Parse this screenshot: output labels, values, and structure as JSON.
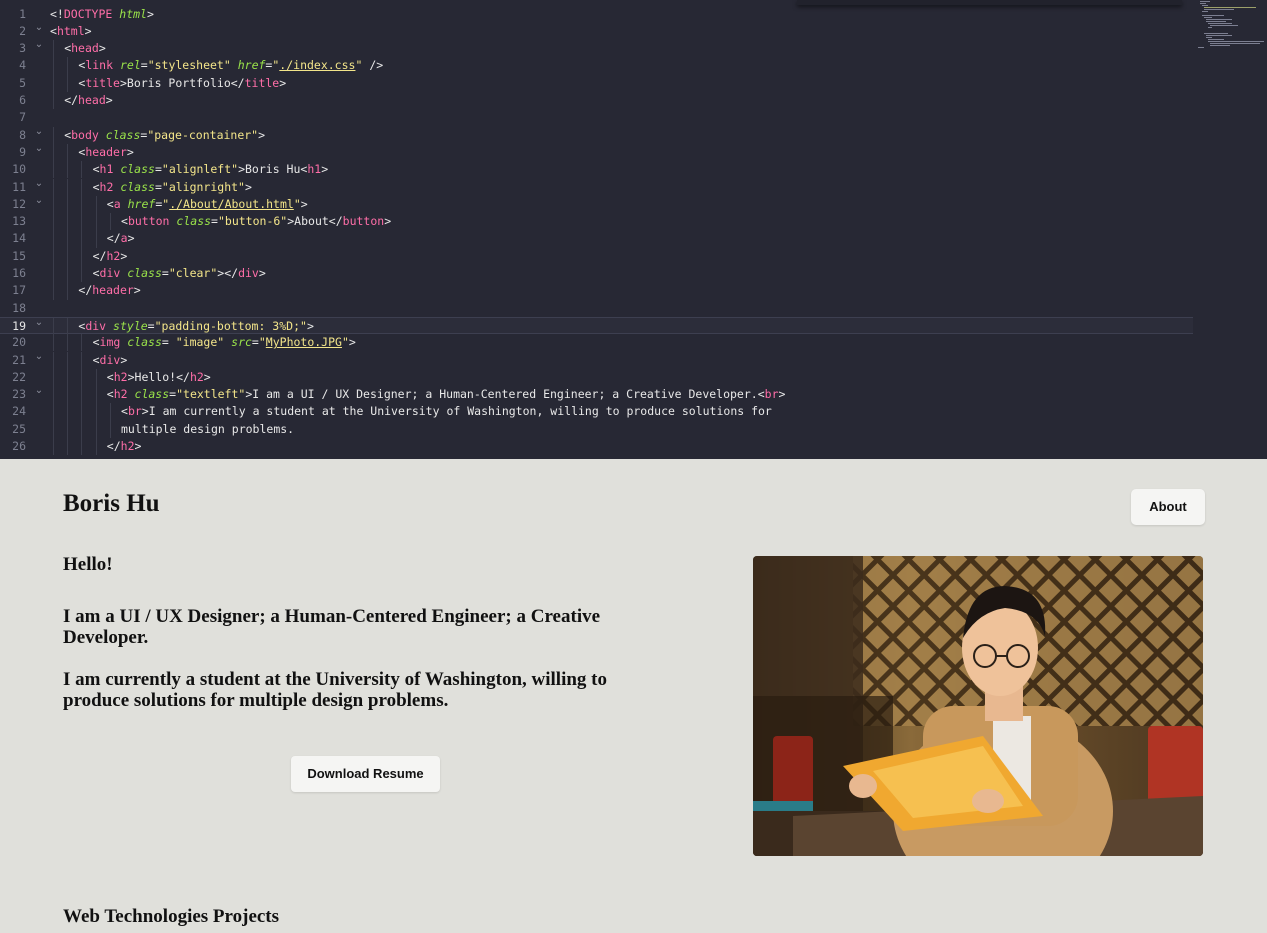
{
  "editor": {
    "lines": [
      {
        "n": "1",
        "fold": "",
        "indent": 0,
        "tokens": [
          [
            "punc",
            "<!"
          ],
          [
            "kw",
            "DOCTYPE"
          ],
          [
            "punc",
            " "
          ],
          [
            "ital",
            "html"
          ],
          [
            "punc",
            ">"
          ]
        ]
      },
      {
        "n": "2",
        "fold": "v",
        "indent": 0,
        "tokens": [
          [
            "punc",
            "<"
          ],
          [
            "tag",
            "html"
          ],
          [
            "punc",
            ">"
          ]
        ]
      },
      {
        "n": "3",
        "fold": "v",
        "indent": 1,
        "tokens": [
          [
            "punc",
            "<"
          ],
          [
            "tag",
            "head"
          ],
          [
            "punc",
            ">"
          ]
        ]
      },
      {
        "n": "4",
        "fold": "",
        "indent": 2,
        "tokens": [
          [
            "punc",
            "<"
          ],
          [
            "tag",
            "link"
          ],
          [
            "punc",
            " "
          ],
          [
            "attr",
            "rel"
          ],
          [
            "punc",
            "="
          ],
          [
            "str",
            "\"stylesheet\""
          ],
          [
            "punc",
            " "
          ],
          [
            "attr",
            "href"
          ],
          [
            "punc",
            "="
          ],
          [
            "str",
            "\""
          ],
          [
            "link",
            "./index.css"
          ],
          [
            "str",
            "\""
          ],
          [
            "punc",
            " />"
          ]
        ]
      },
      {
        "n": "5",
        "fold": "",
        "indent": 2,
        "tokens": [
          [
            "punc",
            "<"
          ],
          [
            "tag",
            "title"
          ],
          [
            "punc",
            ">"
          ],
          [
            "text",
            "Boris Portfolio"
          ],
          [
            "punc",
            "</"
          ],
          [
            "tag",
            "title"
          ],
          [
            "punc",
            ">"
          ]
        ]
      },
      {
        "n": "6",
        "fold": "",
        "indent": 1,
        "tokens": [
          [
            "punc",
            "</"
          ],
          [
            "tag",
            "head"
          ],
          [
            "punc",
            ">"
          ]
        ]
      },
      {
        "n": "7",
        "fold": "",
        "indent": 0,
        "tokens": []
      },
      {
        "n": "8",
        "fold": "v",
        "indent": 1,
        "tokens": [
          [
            "punc",
            "<"
          ],
          [
            "tag",
            "body"
          ],
          [
            "punc",
            " "
          ],
          [
            "attr",
            "class"
          ],
          [
            "punc",
            "="
          ],
          [
            "str",
            "\"page-container\""
          ],
          [
            "punc",
            ">"
          ]
        ]
      },
      {
        "n": "9",
        "fold": "v",
        "indent": 2,
        "tokens": [
          [
            "punc",
            "<"
          ],
          [
            "tag",
            "header"
          ],
          [
            "punc",
            ">"
          ]
        ]
      },
      {
        "n": "10",
        "fold": "",
        "indent": 3,
        "tokens": [
          [
            "punc",
            "<"
          ],
          [
            "tag",
            "h1"
          ],
          [
            "punc",
            " "
          ],
          [
            "attr",
            "class"
          ],
          [
            "punc",
            "="
          ],
          [
            "str",
            "\"alignleft\""
          ],
          [
            "punc",
            ">"
          ],
          [
            "text",
            "Boris Hu"
          ],
          [
            "punc",
            "<"
          ],
          [
            "tag",
            "h1"
          ],
          [
            "punc",
            ">"
          ]
        ]
      },
      {
        "n": "11",
        "fold": "v",
        "indent": 3,
        "tokens": [
          [
            "punc",
            "<"
          ],
          [
            "tag",
            "h2"
          ],
          [
            "punc",
            " "
          ],
          [
            "attr",
            "class"
          ],
          [
            "punc",
            "="
          ],
          [
            "str",
            "\"alignright\""
          ],
          [
            "punc",
            ">"
          ]
        ]
      },
      {
        "n": "12",
        "fold": "v",
        "indent": 4,
        "tokens": [
          [
            "punc",
            "<"
          ],
          [
            "tag",
            "a"
          ],
          [
            "punc",
            " "
          ],
          [
            "attr",
            "href"
          ],
          [
            "punc",
            "="
          ],
          [
            "str",
            "\""
          ],
          [
            "link",
            "./About/About.html"
          ],
          [
            "str",
            "\""
          ],
          [
            "punc",
            ">"
          ]
        ]
      },
      {
        "n": "13",
        "fold": "",
        "indent": 5,
        "tokens": [
          [
            "punc",
            "<"
          ],
          [
            "tag",
            "button"
          ],
          [
            "punc",
            " "
          ],
          [
            "attr",
            "class"
          ],
          [
            "punc",
            "="
          ],
          [
            "str",
            "\"button-6\""
          ],
          [
            "punc",
            ">"
          ],
          [
            "text",
            "About"
          ],
          [
            "punc",
            "</"
          ],
          [
            "tag",
            "button"
          ],
          [
            "punc",
            ">"
          ]
        ]
      },
      {
        "n": "14",
        "fold": "",
        "indent": 4,
        "tokens": [
          [
            "punc",
            "</"
          ],
          [
            "tag",
            "a"
          ],
          [
            "punc",
            ">"
          ]
        ]
      },
      {
        "n": "15",
        "fold": "",
        "indent": 3,
        "tokens": [
          [
            "punc",
            "</"
          ],
          [
            "tag",
            "h2"
          ],
          [
            "punc",
            ">"
          ]
        ]
      },
      {
        "n": "16",
        "fold": "",
        "indent": 3,
        "tokens": [
          [
            "punc",
            "<"
          ],
          [
            "tag",
            "div"
          ],
          [
            "punc",
            " "
          ],
          [
            "attr",
            "class"
          ],
          [
            "punc",
            "="
          ],
          [
            "str",
            "\"clear\""
          ],
          [
            "punc",
            "></"
          ],
          [
            "tag",
            "div"
          ],
          [
            "punc",
            ">"
          ]
        ]
      },
      {
        "n": "17",
        "fold": "",
        "indent": 2,
        "tokens": [
          [
            "punc",
            "</"
          ],
          [
            "tag",
            "header"
          ],
          [
            "punc",
            ">"
          ]
        ]
      },
      {
        "n": "18",
        "fold": "",
        "indent": 0,
        "tokens": []
      },
      {
        "n": "19",
        "fold": "v",
        "indent": 2,
        "active": true,
        "tokens": [
          [
            "punc",
            "<"
          ],
          [
            "tag",
            "div"
          ],
          [
            "punc",
            " "
          ],
          [
            "attr",
            "style"
          ],
          [
            "punc",
            "="
          ],
          [
            "str",
            "\"padding-bottom: 3%D;\""
          ],
          [
            "punc",
            ">"
          ]
        ]
      },
      {
        "n": "20",
        "fold": "",
        "indent": 3,
        "tokens": [
          [
            "punc",
            "<"
          ],
          [
            "tag",
            "img"
          ],
          [
            "punc",
            " "
          ],
          [
            "attr",
            "class"
          ],
          [
            "punc",
            "= "
          ],
          [
            "str",
            "\"image\""
          ],
          [
            "punc",
            " "
          ],
          [
            "attr",
            "src"
          ],
          [
            "punc",
            "="
          ],
          [
            "str",
            "\""
          ],
          [
            "link",
            "MyPhoto.JPG"
          ],
          [
            "str",
            "\""
          ],
          [
            "punc",
            ">"
          ]
        ]
      },
      {
        "n": "21",
        "fold": "v",
        "indent": 3,
        "tokens": [
          [
            "punc",
            "<"
          ],
          [
            "tag",
            "div"
          ],
          [
            "punc",
            ">"
          ]
        ]
      },
      {
        "n": "22",
        "fold": "",
        "indent": 4,
        "tokens": [
          [
            "punc",
            "<"
          ],
          [
            "tag",
            "h2"
          ],
          [
            "punc",
            ">"
          ],
          [
            "text",
            "Hello!"
          ],
          [
            "punc",
            "</"
          ],
          [
            "tag",
            "h2"
          ],
          [
            "punc",
            ">"
          ]
        ]
      },
      {
        "n": "23",
        "fold": "v",
        "indent": 4,
        "tokens": [
          [
            "punc",
            "<"
          ],
          [
            "tag",
            "h2"
          ],
          [
            "punc",
            " "
          ],
          [
            "attr",
            "class"
          ],
          [
            "punc",
            "="
          ],
          [
            "str",
            "\"textleft\""
          ],
          [
            "punc",
            ">"
          ],
          [
            "text",
            "I am a UI / UX Designer; a Human-Centered Engineer; a Creative Developer."
          ],
          [
            "punc",
            "<"
          ],
          [
            "tag",
            "br"
          ],
          [
            "punc",
            ">"
          ]
        ]
      },
      {
        "n": "24",
        "fold": "",
        "indent": 5,
        "tokens": [
          [
            "punc",
            "<"
          ],
          [
            "tag",
            "br"
          ],
          [
            "punc",
            ">"
          ],
          [
            "text",
            "I am currently a student at the University of Washington, willing to produce solutions for"
          ]
        ]
      },
      {
        "n": "25",
        "fold": "",
        "indent": 5,
        "tokens": [
          [
            "text",
            "multiple design problems."
          ]
        ]
      },
      {
        "n": "26",
        "fold": "",
        "indent": 4,
        "tokens": [
          [
            "punc",
            "</"
          ],
          [
            "tag",
            "h2"
          ],
          [
            "punc",
            ">"
          ]
        ]
      }
    ]
  },
  "preview": {
    "site_name": "Boris Hu",
    "about_button": "About",
    "hello": "Hello!",
    "intro_line1": "I am a UI / UX Designer; a Human-Centered Engineer; a Creative Developer.",
    "intro_line2": "I am currently a student at the University of Washington, willing to produce solutions for multiple design problems.",
    "resume_button": "Download Resume",
    "photo_alt": "Portrait photo",
    "projects_heading": "Web Technologies Projects"
  },
  "colors": {
    "editor_bg": "#272834",
    "tag": "#ff6ea8",
    "attribute": "#9ae34a",
    "string": "#f3e58a",
    "page_bg": "#e0e0db"
  }
}
